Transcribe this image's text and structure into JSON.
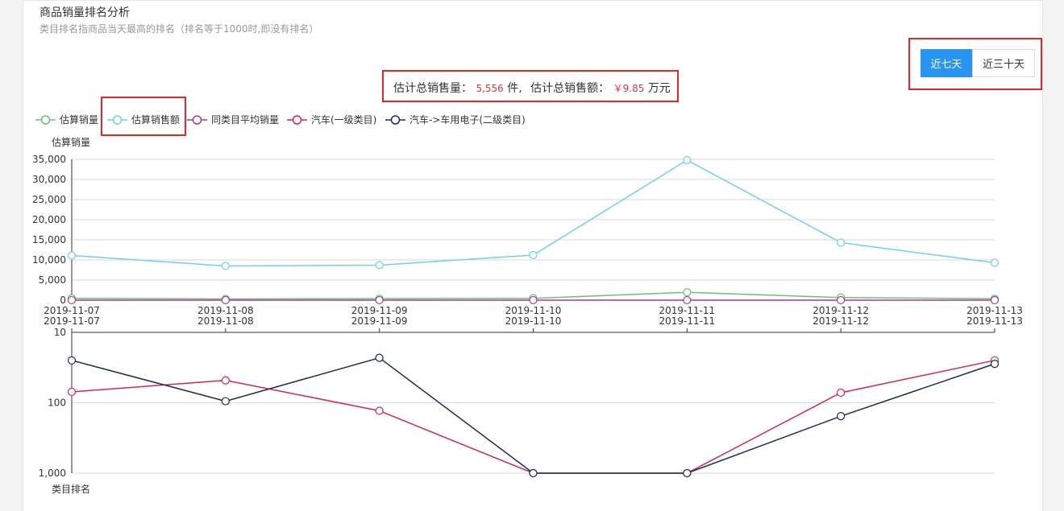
{
  "header": {
    "title": "商品销量排名分析",
    "subtitle": "类目排名指商品当天最高的排名（排名等于1000时,即没有排名）"
  },
  "range_buttons": [
    {
      "label": "近七天",
      "active": true
    },
    {
      "label": "近三十天",
      "active": false
    }
  ],
  "summary": {
    "qty_label": "估计总销售量：",
    "qty_value": "5,556",
    "qty_unit": "件,",
    "amount_label": "估计总销售额：",
    "amount_value": "￥9.85",
    "amount_unit": "万元"
  },
  "colors": {
    "active_button": "#2896f0",
    "highlight_box": "#e62525",
    "summary_value": "#e5323c"
  },
  "chart_data": [
    {
      "type": "line",
      "ylabel": "估算销量",
      "ylim": [
        0,
        35000
      ],
      "yticks": [
        "0",
        "5,000",
        "10,000",
        "15,000",
        "20,000",
        "25,000",
        "30,000",
        "35,000"
      ],
      "categories": [
        "2019-11-07",
        "2019-11-08",
        "2019-11-09",
        "2019-11-10",
        "2019-11-11",
        "2019-11-12",
        "2019-11-13"
      ],
      "grid": true,
      "legend": "top-left",
      "series": [
        {
          "name": "估算销量",
          "color": "#6cc07a",
          "values": [
            450,
            300,
            380,
            450,
            1950,
            650,
            350
          ]
        },
        {
          "name": "估算销售额",
          "color": "#6fcff3",
          "values": [
            11100,
            8500,
            8700,
            11200,
            34800,
            14300,
            9300
          ]
        },
        {
          "name": "同类目平均销量",
          "color": "#a63a8c",
          "values": [
            10,
            10,
            10,
            10,
            10,
            10,
            10
          ]
        }
      ]
    },
    {
      "type": "line",
      "ylabel": "类目排名",
      "yscale": "log",
      "inverted": true,
      "ylim": [
        10,
        1000
      ],
      "yticks": [
        "10",
        "100",
        "1,000"
      ],
      "categories": [
        "2019-11-07",
        "2019-11-08",
        "2019-11-09",
        "2019-11-10",
        "2019-11-11",
        "2019-11-12",
        "2019-11-13"
      ],
      "grid": true,
      "series": [
        {
          "name": "汽车(一级类目)",
          "color": "#d6245a",
          "values": [
            70,
            48,
            130,
            1000,
            1000,
            72,
            25
          ]
        },
        {
          "name": "汽车->车用电子(二级类目)",
          "color": "#1b2a5c",
          "values": [
            25,
            95,
            23,
            1000,
            1000,
            155,
            28
          ]
        }
      ]
    }
  ]
}
